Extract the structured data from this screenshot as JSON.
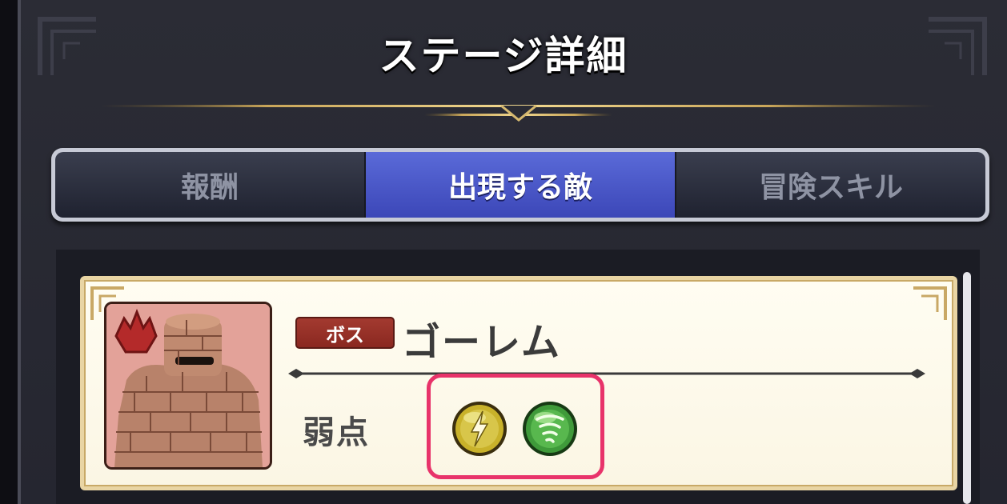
{
  "screen": {
    "title": "ステージ詳細"
  },
  "tabs": [
    {
      "label": "報酬",
      "active": false
    },
    {
      "label": "出現する敵",
      "active": true
    },
    {
      "label": "冒険スキル",
      "active": false
    }
  ],
  "enemy": {
    "badge": "ボス",
    "name": "ゴーレム",
    "weakness_label": "弱点",
    "weaknesses": [
      {
        "icon": "lightning-icon",
        "color": "#c9b22a"
      },
      {
        "icon": "tornado-icon",
        "color": "#3f9a3a"
      }
    ]
  },
  "colors": {
    "active_tab": "#4b58c8",
    "highlight": "#e8336a",
    "boss_badge": "#9a3027"
  }
}
